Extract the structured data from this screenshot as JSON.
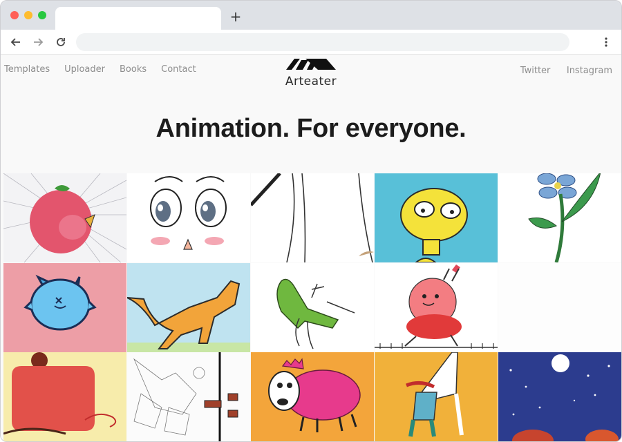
{
  "browser": {
    "new_tab_icon": "+",
    "back_icon": "arrow-left-icon",
    "forward_icon": "arrow-right-icon",
    "reload_icon": "reload-icon",
    "menu_icon": "kebab-menu-icon"
  },
  "site": {
    "nav_left": [
      "Templates",
      "Uploader",
      "Books",
      "Contact"
    ],
    "nav_right": [
      "Twitter",
      "Instagram"
    ],
    "logo_text": "Arteater",
    "headline": "Animation. For everyone."
  },
  "gallery": {
    "items": [
      {
        "subject": "strawberry-bird"
      },
      {
        "subject": "cartoon-eyes-face"
      },
      {
        "subject": "line-sketch"
      },
      {
        "subject": "yellow-creature"
      },
      {
        "subject": "blue-flower"
      },
      {
        "subject": "blue-cat"
      },
      {
        "subject": "orange-cat"
      },
      {
        "subject": "green-figure"
      },
      {
        "subject": "pink-robot"
      },
      {
        "subject": "blank"
      },
      {
        "subject": "red-shape"
      },
      {
        "subject": "pencil-sketch"
      },
      {
        "subject": "pink-sheep"
      },
      {
        "subject": "giraffe-figure"
      },
      {
        "subject": "night-sky-moon"
      }
    ]
  },
  "colors": {
    "background": "#f9f9f9",
    "nav_text": "#8d8d8d",
    "headline": "#1c1c1c"
  }
}
